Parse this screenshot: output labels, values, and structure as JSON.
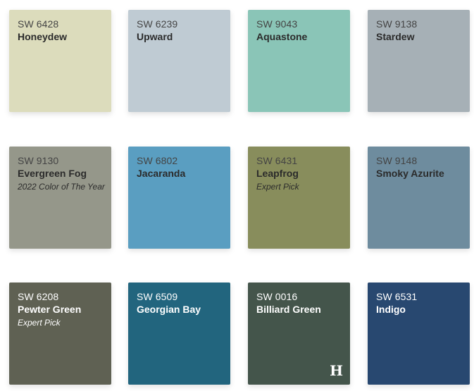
{
  "swatches": [
    {
      "code": "SW 6428",
      "name": "Honeydew",
      "tag": "",
      "color": "#dcdcbc",
      "text": "dark"
    },
    {
      "code": "SW 6239",
      "name": "Upward",
      "tag": "",
      "color": "#bfcbd3",
      "text": "dark"
    },
    {
      "code": "SW 9043",
      "name": "Aquastone",
      "tag": "",
      "color": "#8ac5b7",
      "text": "dark"
    },
    {
      "code": "SW 9138",
      "name": "Stardew",
      "tag": "",
      "color": "#a6b0b6",
      "text": "dark"
    },
    {
      "code": "SW 9130",
      "name": "Evergreen Fog",
      "tag": "2022 Color of The Year",
      "color": "#95978a",
      "text": "dark"
    },
    {
      "code": "SW 6802",
      "name": "Jacaranda",
      "tag": "",
      "color": "#5a9ec1",
      "text": "dark"
    },
    {
      "code": "SW 6431",
      "name": "Leapfrog",
      "tag": "Expert Pick",
      "color": "#888d5c",
      "text": "dark"
    },
    {
      "code": "SW 9148",
      "name": "Smoky Azurite",
      "tag": "",
      "color": "#6e8c9e",
      "text": "dark"
    },
    {
      "code": "SW 6208",
      "name": "Pewter Green",
      "tag": "Expert Pick",
      "color": "#5f6153",
      "text": "light"
    },
    {
      "code": "SW 6509",
      "name": "Georgian Bay",
      "tag": "",
      "color": "#22657e",
      "text": "light"
    },
    {
      "code": "SW 0016",
      "name": "Billiard Green",
      "tag": "",
      "color": "#44554b",
      "text": "light"
    },
    {
      "code": "SW 6531",
      "name": "Indigo",
      "tag": "",
      "color": "#284870",
      "text": "light"
    }
  ],
  "logo": {
    "glyph": "H",
    "color": "#ffffff"
  }
}
